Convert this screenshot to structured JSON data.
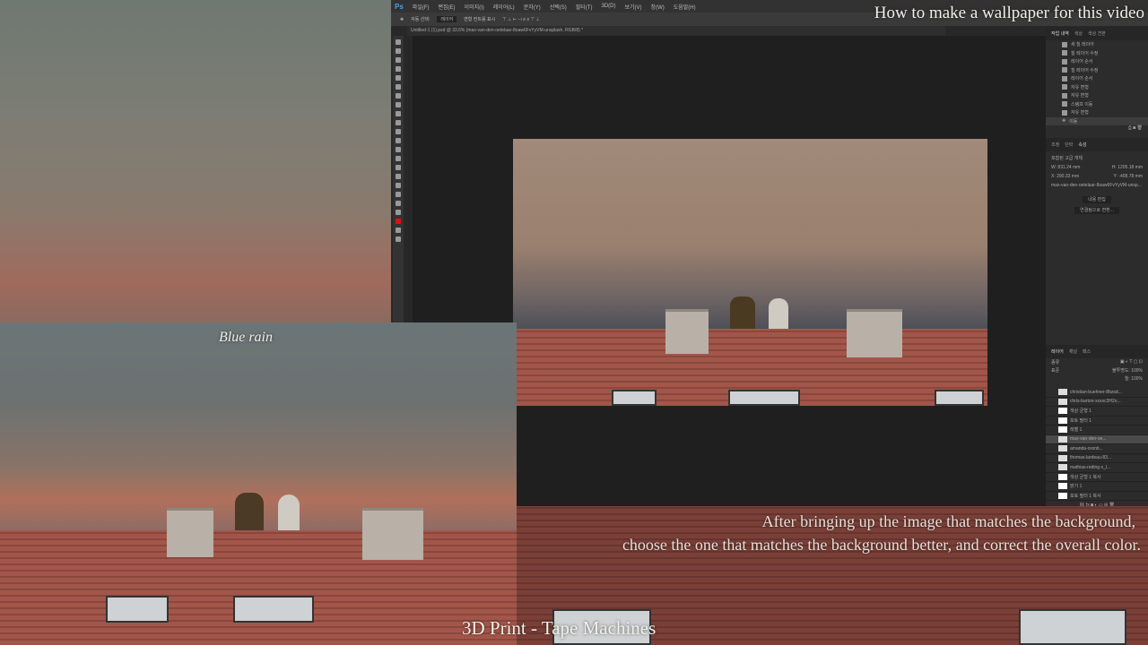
{
  "video": {
    "title": "How to make a wallpaper for this video",
    "caption_line1": "After bringing up the image that matches the background,",
    "caption_line2": "choose the one that matches the background better, and correct the overall color.",
    "song": "3D Print - Tape Machines",
    "logo_text": "Blue rain"
  },
  "photoshop": {
    "logo": "Ps",
    "menu": [
      "파일(F)",
      "편집(E)",
      "이미지(I)",
      "레이어(L)",
      "문자(Y)",
      "선택(S)",
      "필터(T)",
      "3D(D)",
      "보기(V)",
      "창(W)",
      "도움말(H)"
    ],
    "options": {
      "auto_select": "자동 선택:",
      "auto_select_value": "레이어",
      "transform_controls": "변형 컨트롤 표시"
    },
    "doc_tab": "Untitled-1 (1).psd @ 33.6% (max-van-den-oetelaar-8oaw6FvYyVM-unsplash, RGB/8) *",
    "history": {
      "tabs": [
        "작업 내역",
        "색상",
        "색상 견본"
      ],
      "items": [
        "새 칠 레이어",
        "칠 레이어 수정",
        "레이어 순서",
        "칠 레이어 수정",
        "레이어 순서",
        "자유 변형",
        "자유 변형",
        "스탬프 이동",
        "자유 변형",
        "이동"
      ]
    },
    "properties": {
      "tabs": [
        "조정",
        "단락",
        "속성"
      ],
      "type": "포함된 고급 개체",
      "w": "W: 831.24 mm",
      "h": "H: 1205.18 mm",
      "x": "X: 290.33 mm",
      "y": "Y: -408.78 mm",
      "file": "max-van-den-oetelaar-8oaw6FvYyVM-unsp...",
      "edit_btn": "내용 편집",
      "convert_btn": "연결됨으로 변환..."
    },
    "layers": {
      "tabs": [
        "레이어",
        "채널",
        "패스"
      ],
      "kind": "종류",
      "blend": "표준",
      "opacity": "불투명도: 100%",
      "fill": "칠: 100%",
      "items": [
        "christian-buehner-8bzsd...",
        "chris-barton-xxxxc3H2o...",
        "색상 균형 1",
        "포토 필터 1",
        "레벨 1",
        "max-van-den-oe...",
        "amanda-xxxnti...",
        "thomas-lardeau-83...",
        "mathias-reding-x_l...",
        "색상 균형 1 복사",
        "밝기 1",
        "포토 필터 1 복사"
      ]
    }
  }
}
